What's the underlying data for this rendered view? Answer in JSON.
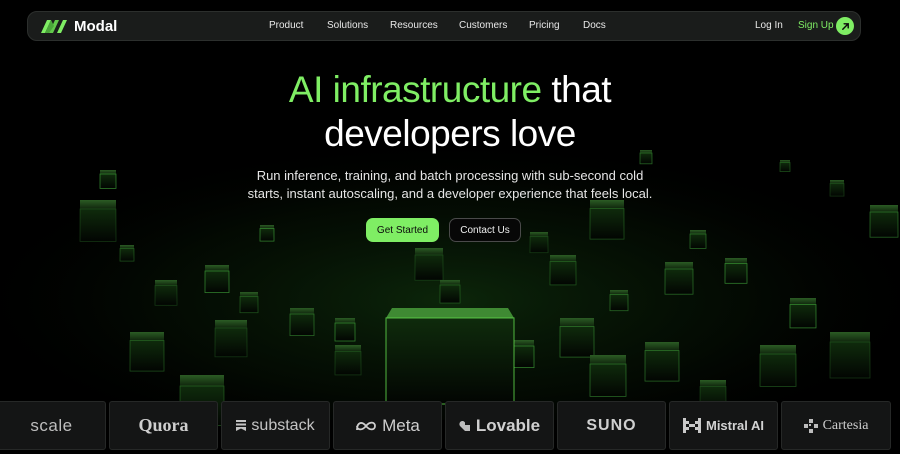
{
  "nav": {
    "brand": "Modal",
    "links": [
      "Product",
      "Solutions",
      "Resources",
      "Customers",
      "Pricing",
      "Docs"
    ],
    "login": "Log In",
    "signup": "Sign Up"
  },
  "hero": {
    "headline_green": "AI infrastructure",
    "headline_white": "that",
    "headline_line2": "developers love",
    "subtext_line1": "Run inference, training, and batch processing with sub-second cold",
    "subtext_line2": "starts, instant autoscaling, and a developer experience that feels local.",
    "primary_cta": "Get Started",
    "secondary_cta": "Contact Us"
  },
  "customers": {
    "logos": [
      "scale",
      "Quora",
      "substack",
      "Meta",
      "Lovable",
      "SUNO",
      "Mistral AI",
      "Cartesia"
    ]
  },
  "colors": {
    "accent": "#7fee64",
    "background": "#000000",
    "nav_bg": "#1a1c1b"
  }
}
